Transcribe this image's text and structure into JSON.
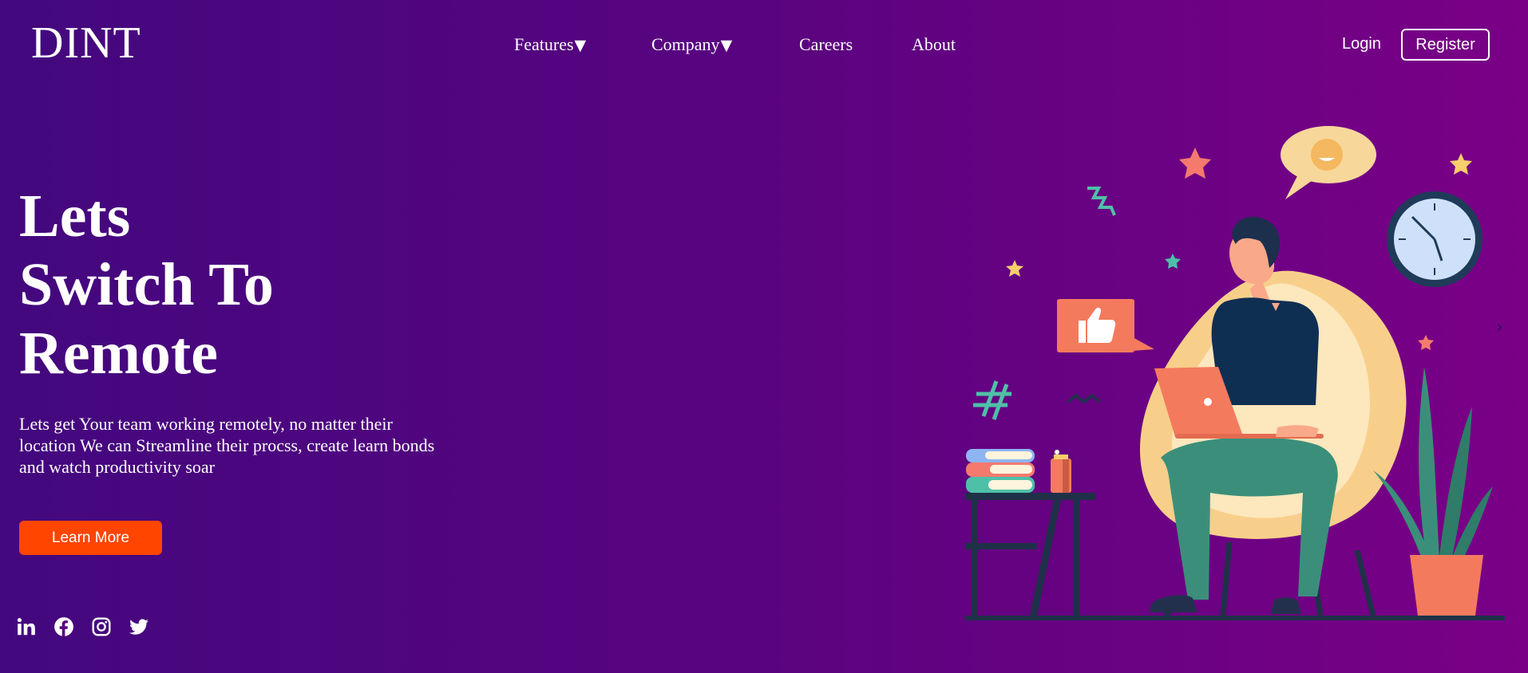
{
  "brand": {
    "name": "DINT"
  },
  "nav": {
    "items": [
      {
        "label": "Features",
        "caret": "▼"
      },
      {
        "label": "Company",
        "caret": "▼"
      },
      {
        "label": "Careers"
      },
      {
        "label": "About"
      }
    ]
  },
  "auth": {
    "login_label": "Login",
    "register_label": "Register"
  },
  "hero": {
    "title_lines": [
      "Lets",
      "Switch To",
      "Remote"
    ],
    "description": "Lets get Your team working remotely, no matter their location We can Streamline their procss, create learn bonds and watch productivity soar",
    "cta_label": "Learn More"
  },
  "social": [
    "linkedin-icon",
    "facebook-icon",
    "instagram-icon",
    "twitter-icon"
  ],
  "colors": {
    "bg_start": "#43087e",
    "bg_end": "#7a0086",
    "cta": "#ff4500",
    "text": "#ffffff"
  },
  "slider": {
    "next_glyph": "›"
  }
}
